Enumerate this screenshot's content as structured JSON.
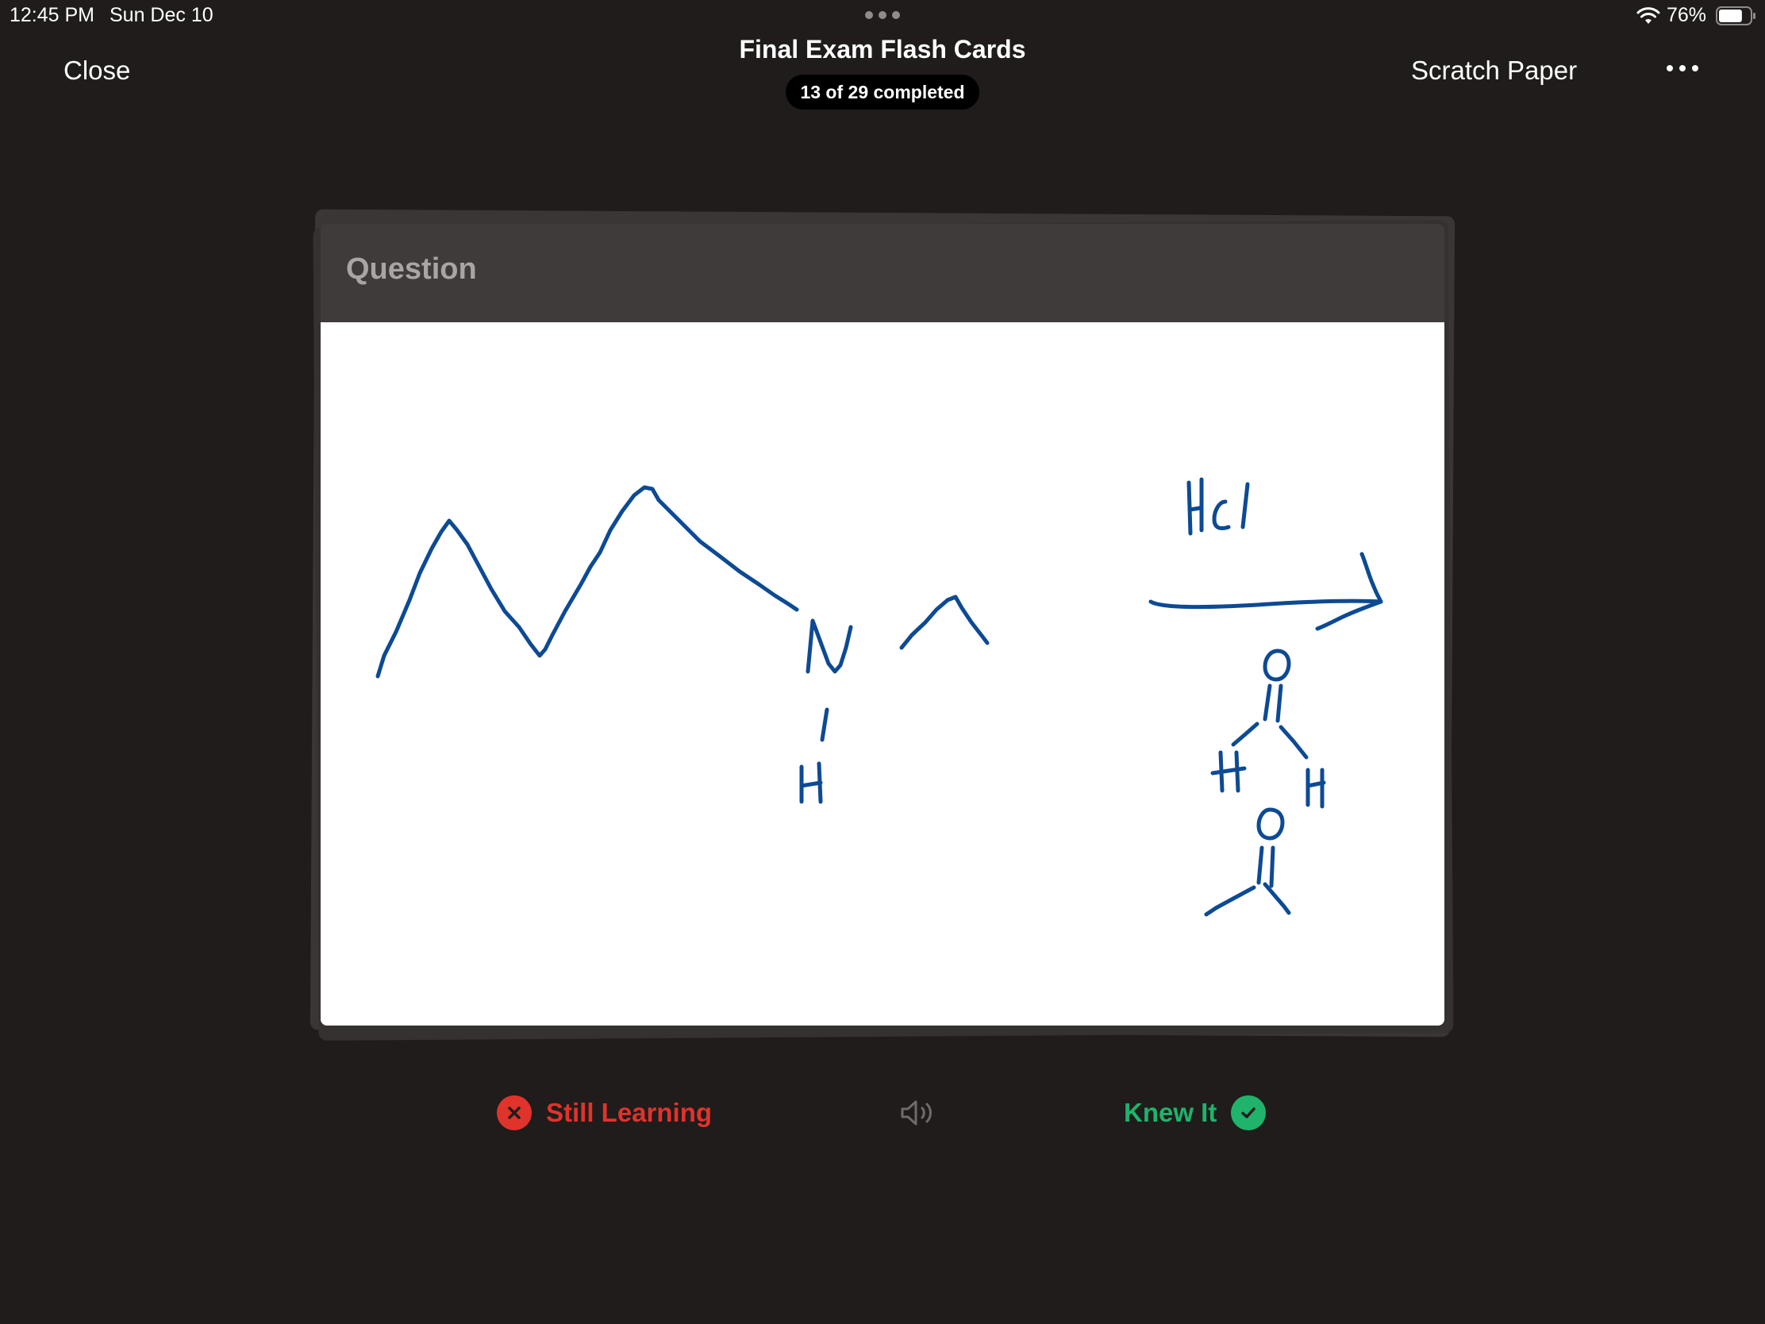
{
  "status_bar": {
    "time": "12:45 PM",
    "date": "Sun Dec 10",
    "battery_percent": "76%",
    "battery_level": 0.76
  },
  "nav": {
    "close_label": "Close",
    "title": "Final Exam Flash Cards",
    "progress": "13 of 29 completed",
    "completed": 13,
    "total": 29,
    "scratch_label": "Scratch Paper",
    "more_icon": "ellipsis-icon"
  },
  "card": {
    "side_label": "Question",
    "handwritten_text": {
      "reagent": "HCl",
      "nitrogen": "N",
      "hydrogen_amine": "H",
      "oxygen_1": "O",
      "hydrogen_left": "H",
      "hydrogen_right": "H",
      "oxygen_2": "O"
    },
    "ink_color": "#0d4a94"
  },
  "actions": {
    "still_learning_label": "Still Learning",
    "still_learning_color": "#e0332c",
    "knew_it_label": "Knew It",
    "knew_it_color": "#1fb36b",
    "sound_icon": "speaker-icon"
  }
}
